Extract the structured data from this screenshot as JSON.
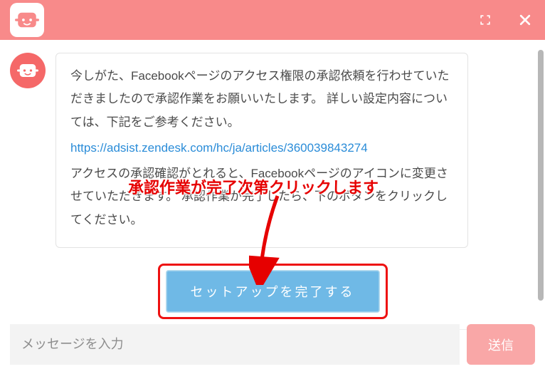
{
  "header": {
    "expand_icon": "expand-icon",
    "close_icon": "close-icon"
  },
  "message": {
    "p1": "今しがた、Facebookページのアクセス権限の承認依頼を行わせていただきましたので承認作業をお願いいたします。 詳しい設定内容については、下記をご参考ください。",
    "link_text": "https://adsist.zendesk.com/hc/ja/articles/360039843274",
    "link_href": "https://adsist.zendesk.com/hc/ja/articles/360039843274",
    "p2": "アクセスの承認確認がとれると、Facebookページのアイコンに変更させていただきます。 承認作業が完了したら、下のボタンをクリックしてください。"
  },
  "action": {
    "complete_label": "セットアップを完了する"
  },
  "annotation": {
    "text": "承認作業が完了次第クリックします"
  },
  "footer": {
    "placeholder": "メッセージを入力",
    "send_label": "送信"
  },
  "colors": {
    "brand": "#f88a8a",
    "accent_btn": "#6fb9e6",
    "danger": "#e60000"
  }
}
